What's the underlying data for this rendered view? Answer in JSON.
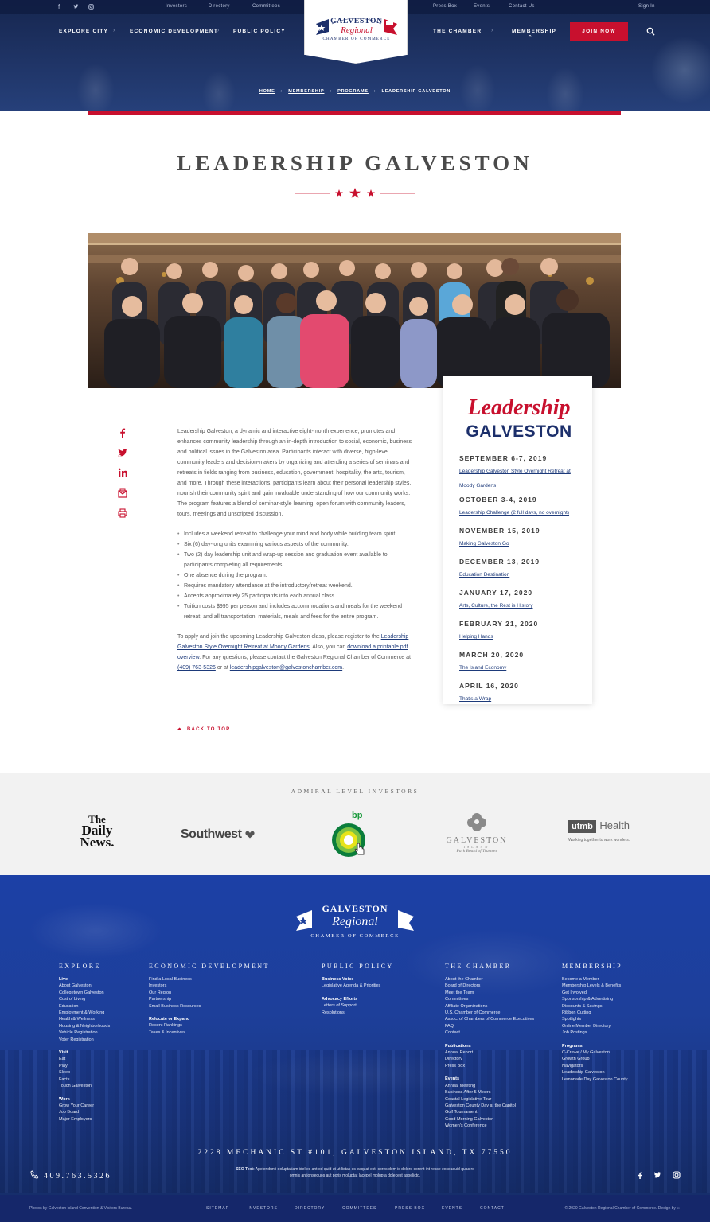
{
  "utility": {
    "links": [
      "Investors",
      "Directory",
      "Committees",
      "Press Box",
      "Events",
      "Contact Us"
    ],
    "signin": "Sign In"
  },
  "nav": {
    "left": [
      "EXPLORE CITY",
      "ECONOMIC DEVELOPMENT",
      "PUBLIC POLICY"
    ],
    "right": [
      "THE CHAMBER",
      "MEMBERSHIP"
    ],
    "join": "JOIN NOW"
  },
  "logo": {
    "line1": "GALVESTON",
    "line2": "Regional",
    "line3": "CHAMBER OF COMMERCE"
  },
  "breadcrumb": [
    "HOME",
    "MEMBERSHIP",
    "PROGRAMS",
    "LEADERSHIP GALVESTON"
  ],
  "page_title": "LEADERSHIP GALVESTON",
  "intro": "Leadership Galveston, a dynamic and interactive eight-month experience, promotes and enhances community leadership through an in-depth introduction to social, economic, business and political issues in the Galveston area. Participants interact with diverse, high-level community leaders and decision-makers by organizing and attending a series of seminars and retreats in fields ranging from business, education, government, hospitality, the arts, tourism, and more. Through these interactions, participants learn about their personal leadership styles, nourish their community spirit and gain invaluable understanding of how our community works. The program features a blend of seminar-style learning, open forum with community leaders, tours, meetings and unscripted discussion.",
  "bullets": [
    "Includes a weekend retreat to challenge your mind and body while building team spirit.",
    "Six (6) day-long units examining various aspects of the community.",
    "Two (2) day leadership unit and wrap-up session and graduation event available to participants completing all requirements.",
    "One absence during the program.",
    "Requires mandatory attendance at the introductory/retreat weekend.",
    "Accepts approximately 25 participants into each annual class.",
    "Tuition costs $995 per person and includes accommodations and meals for the weekend retreat; and all transportation, materials, meals and fees for the entire program."
  ],
  "apply": {
    "t1": "To apply and join the upcoming Leadership Galveston class, please register to the ",
    "link1": "Leadership Galveston Style Overnight Retreat at Moody Gardens",
    "t2": ". Also, you can ",
    "link2": "download a printable pdf overview",
    "t3": ". For any questions, please contact the Galveston Regional Chamber of Commerce at ",
    "phone": "(409) 763-5326",
    "t4": " or at ",
    "email": "leadershipgalveston@galvestonchamber.com",
    "t5": "."
  },
  "back_to_top": "BACK TO TOP",
  "sidebar": {
    "logo_script": "Leadership",
    "logo_word": "GALVESTON",
    "events": [
      {
        "date": "SEPTEMBER 6-7, 2019",
        "title": "Leadership Galveston Style Overnight Retreat at Moody Gardens"
      },
      {
        "date": "OCTOBER 3-4, 2019",
        "title": "Leadership Challenge (2 full days, no overnight)"
      },
      {
        "date": "NOVEMBER 15, 2019",
        "title": "Making Galveston Go"
      },
      {
        "date": "DECEMBER 13, 2019",
        "title": "Education Destination"
      },
      {
        "date": "JANUARY 17, 2020",
        "title": "Arts, Culture, the Rest is History"
      },
      {
        "date": "FEBRUARY 21, 2020",
        "title": "Helping Hands"
      },
      {
        "date": "MARCH 20, 2020",
        "title": "The Island Economy"
      },
      {
        "date": "APRIL 16, 2020",
        "title": "That's a Wrap"
      }
    ]
  },
  "investors": {
    "title": "ADMIRAL LEVEL INVESTORS",
    "daily_news": [
      "The",
      "Daily",
      "News."
    ],
    "southwest": "Southwest",
    "bp": "bp",
    "galveston_park": {
      "name": "GALVESTON",
      "sub": "ISLAND",
      "tag": "Park Board of Trustees"
    },
    "utmb": {
      "box": "utmb",
      "word": "Health",
      "tag": "Working together to work wonders."
    }
  },
  "footer": {
    "columns": [
      {
        "title": "EXPLORE",
        "groups": [
          {
            "sub": "Live",
            "items": [
              "About Galveston",
              "Collegetown Galveston",
              "Cost of Living",
              "Education",
              "Employment & Working",
              "Health & Wellness",
              "Housing & Neighborhoods",
              "Vehicle Registration",
              "Voter Registration"
            ]
          },
          {
            "sub": "Visit",
            "items": [
              "Eat",
              "Play",
              "Sleep",
              "Facts",
              "Touch Galveston"
            ]
          },
          {
            "sub": "Work",
            "items": [
              "Grow Your Career",
              "Job Board",
              "Major Employers"
            ]
          }
        ]
      },
      {
        "title": "ECONOMIC DEVELOPMENT",
        "groups": [
          {
            "sub": "",
            "items": [
              "Find a Local Business",
              "Investors",
              "Our Region",
              "Partnership",
              "Small Business Resources"
            ]
          },
          {
            "sub": "Relocate or Expand",
            "items": [
              "Recent Rankings",
              "Taxes & Incentives"
            ]
          }
        ]
      },
      {
        "title": "PUBLIC POLICY",
        "groups": [
          {
            "sub": "Business Voice",
            "items": [
              "Legislative Agenda & Priorities"
            ]
          },
          {
            "sub": "Advocacy Efforts",
            "items": [
              "Letters of Support",
              "Resolutions"
            ]
          }
        ]
      },
      {
        "title": "THE CHAMBER",
        "groups": [
          {
            "sub": "",
            "items": [
              "About the Chamber",
              "Board of Directors",
              "Meet the Team",
              "Committees",
              "Affiliate Organizations",
              "U.S. Chamber of Commerce",
              "Assoc. of Chambers of Commerce Executives",
              "FAQ",
              "Contact"
            ]
          },
          {
            "sub": "Publications",
            "items": [
              "Annual Report",
              "Directory",
              "Press Box"
            ]
          },
          {
            "sub": "Events",
            "items": [
              "Annual Meeting",
              "Business After 5 Mixers",
              "Coastal Legislative Tour",
              "Galveston County Day at the Capitol",
              "Golf Tournament",
              "Good Morning Galveston",
              "Women's Conference"
            ]
          }
        ]
      },
      {
        "title": "MEMBERSHIP",
        "groups": [
          {
            "sub": "",
            "items": [
              "Become a Member",
              "Membership Levels & Benefits",
              "Get Involved",
              "Sponsorship & Advertising",
              "Discounts & Savings",
              "Ribbon Cutting",
              "Spotlights",
              "Online Member Directory",
              "Job Postings"
            ]
          },
          {
            "sub": "Programs",
            "items": [
              "C-Crewe / My Galveston",
              "Growth Group",
              "Navigators",
              "Leadership Galveston",
              "Lemonade Day Galveston County"
            ]
          }
        ]
      }
    ],
    "address": "2228 MECHANIC ST #101, GALVESTON ISLAND, TX 77550",
    "phone": "409.763.5326",
    "seo_label": "SEO Text:",
    "seo_text": " Apelendunti doluptatiam idel es ant od quid ut ut listas es eaquat est, cores dem is dolore corent int resse exceaquid quas re omnis antionsequos aut poris moluptat lacepel molupta dolecest aspelicto.",
    "bottom_links": [
      "SITEMAP",
      "INVESTORS",
      "DIRECTORY",
      "COMMITTEES",
      "PRESS BOX",
      "EVENTS",
      "CONTACT"
    ],
    "credit_left": "Photos by Galveston Island Convention & Visitors Bureau.",
    "credit_right": "© 2020 Galveston Regional Chamber of Commerce. Design by ∞"
  },
  "colors": {
    "brand_red": "#c8102e",
    "brand_navy": "#1c2f6b",
    "footer_blue": "#1d3f9a",
    "link_blue": "#1d3a7a"
  }
}
